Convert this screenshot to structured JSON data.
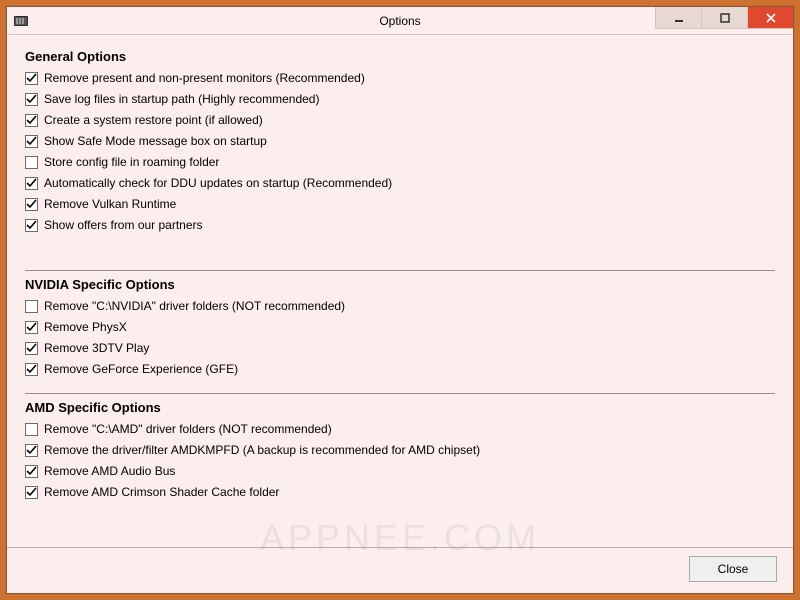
{
  "window": {
    "title": "Options"
  },
  "sections": {
    "general": {
      "title": "General Options",
      "items": [
        {
          "label": "Remove present and non-present monitors (Recommended)",
          "checked": true
        },
        {
          "label": "Save log files in startup path (Highly recommended)",
          "checked": true
        },
        {
          "label": "Create a system restore point (if allowed)",
          "checked": true
        },
        {
          "label": "Show Safe Mode message box on startup",
          "checked": true
        },
        {
          "label": "Store config file in roaming folder",
          "checked": false
        },
        {
          "label": "Automatically check for DDU updates on startup (Recommended)",
          "checked": true
        },
        {
          "label": "Remove Vulkan Runtime",
          "checked": true
        },
        {
          "label": "Show offers from our partners",
          "checked": true
        }
      ]
    },
    "nvidia": {
      "title": "NVIDIA Specific Options",
      "items": [
        {
          "label": "Remove \"C:\\NVIDIA\" driver folders (NOT recommended)",
          "checked": false
        },
        {
          "label": "Remove PhysX",
          "checked": true
        },
        {
          "label": "Remove 3DTV Play",
          "checked": true
        },
        {
          "label": "Remove GeForce Experience (GFE)",
          "checked": true
        }
      ]
    },
    "amd": {
      "title": "AMD Specific Options",
      "items": [
        {
          "label": "Remove \"C:\\AMD\" driver folders (NOT recommended)",
          "checked": false
        },
        {
          "label": "Remove the driver/filter AMDKMPFD (A backup is recommended for AMD chipset)",
          "checked": true
        },
        {
          "label": "Remove AMD Audio Bus",
          "checked": true
        },
        {
          "label": "Remove AMD Crimson Shader Cache folder",
          "checked": true
        }
      ]
    }
  },
  "buttons": {
    "close": "Close"
  },
  "watermark": "APPNEE.COM"
}
